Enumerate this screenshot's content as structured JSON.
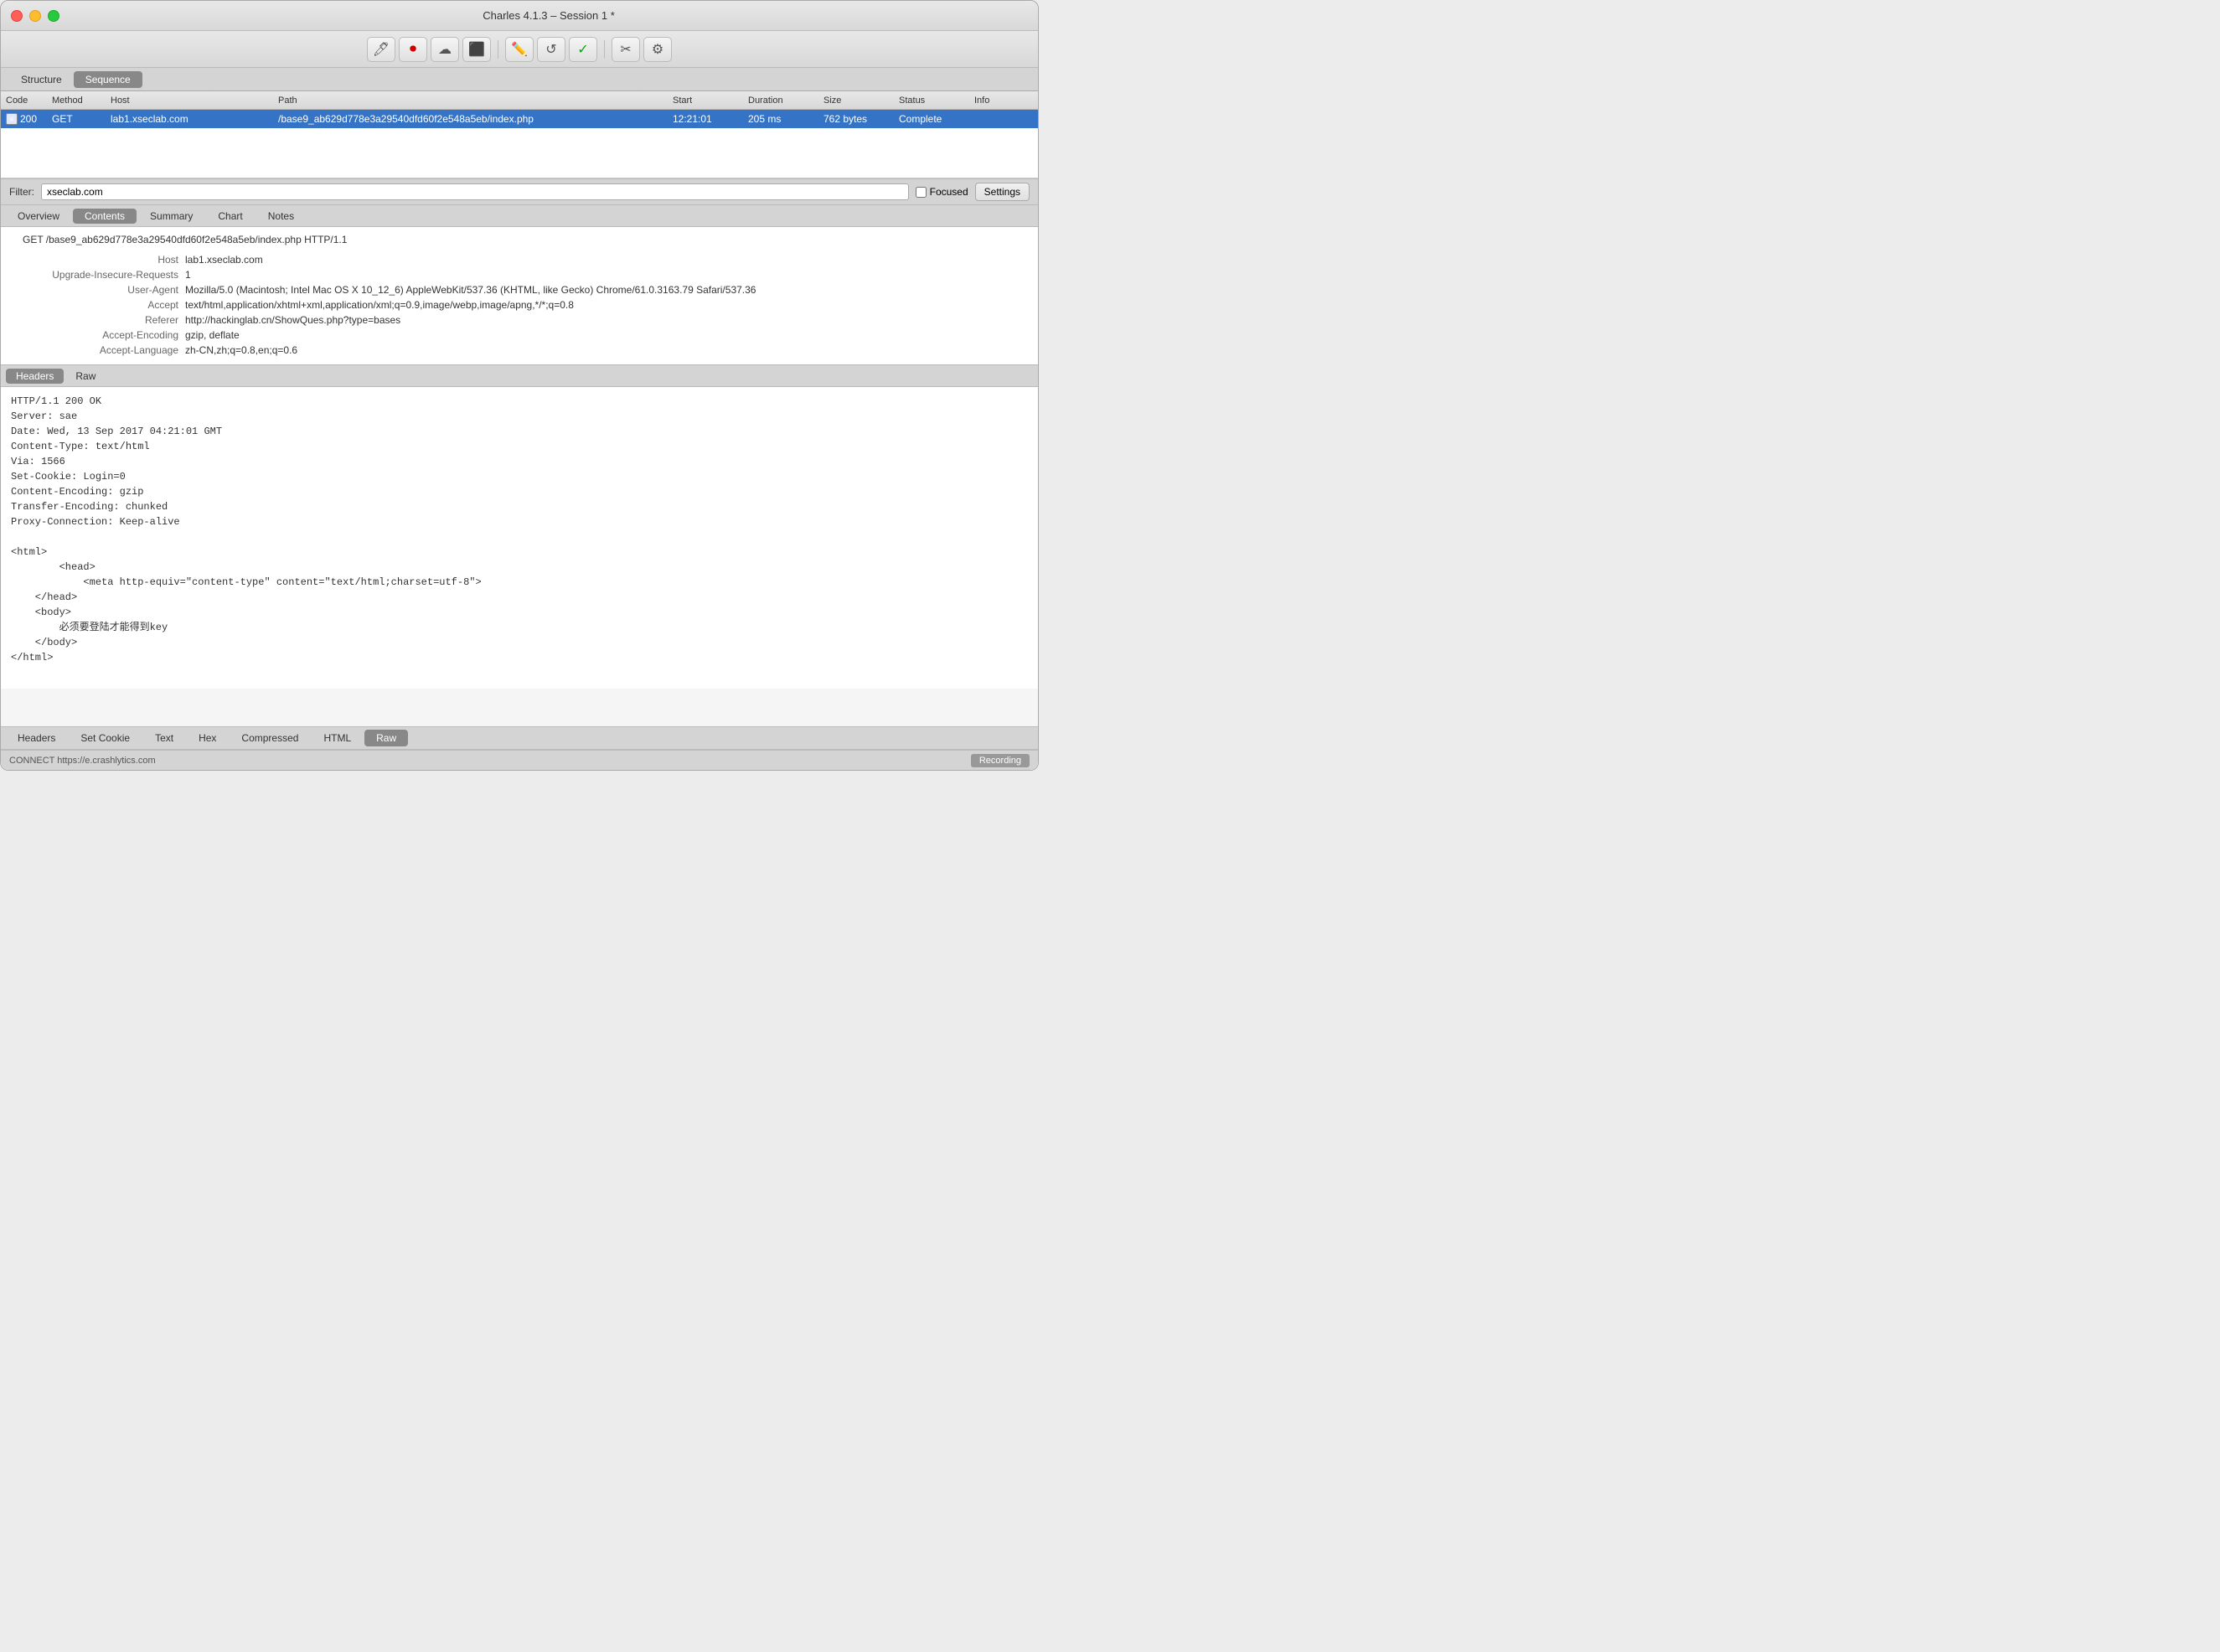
{
  "window": {
    "title": "Charles 4.1.3 – Session 1 *"
  },
  "toolbar": {
    "buttons": [
      {
        "name": "pen-tool",
        "icon": "✏️"
      },
      {
        "name": "record",
        "icon": "⏺"
      },
      {
        "name": "cloud",
        "icon": "☁"
      },
      {
        "name": "stop",
        "icon": "⏹"
      },
      {
        "name": "pencil",
        "icon": "✏"
      },
      {
        "name": "refresh",
        "icon": "↺"
      },
      {
        "name": "checkmark",
        "icon": "✓"
      },
      {
        "name": "tools",
        "icon": "✂"
      },
      {
        "name": "settings",
        "icon": "⚙"
      }
    ]
  },
  "nav": {
    "tabs": [
      "Structure",
      "Sequence"
    ],
    "active": "Sequence"
  },
  "table": {
    "headers": [
      "Code",
      "Method",
      "Host",
      "Path",
      "Start",
      "Duration",
      "Size",
      "Status",
      "Info"
    ],
    "row": {
      "icon": "≡",
      "code": "200",
      "method": "GET",
      "host": "lab1.xseclab.com",
      "path": "/base9_ab629d778e3a29540dfd60f2e548a5eb/index.php",
      "start": "12:21:01",
      "duration": "205 ms",
      "size": "762 bytes",
      "status": "Complete",
      "info": ""
    }
  },
  "filter": {
    "label": "Filter:",
    "value": "xseclab.com",
    "placeholder": "",
    "focused_label": "Focused",
    "settings_label": "Settings"
  },
  "detail": {
    "tabs": [
      "Overview",
      "Contents",
      "Summary",
      "Chart",
      "Notes"
    ],
    "active_tab": "Contents",
    "request_line": "GET /base9_ab629d778e3a29540dfd60f2e548a5eb/index.php HTTP/1.1",
    "headers": [
      {
        "name": "Host",
        "value": "lab1.xseclab.com"
      },
      {
        "name": "Upgrade-Insecure-Requests",
        "value": "1"
      },
      {
        "name": "User-Agent",
        "value": "Mozilla/5.0 (Macintosh; Intel Mac OS X 10_12_6) AppleWebKit/537.36 (KHTML, like Gecko) Chrome/61.0.3163.79 Safari/537.36"
      },
      {
        "name": "Accept",
        "value": "text/html,application/xhtml+xml,application/xml;q=0.9,image/webp,image/apng,*/*;q=0.8"
      },
      {
        "name": "Referer",
        "value": "http://hackinglab.cn/ShowQues.php?type=bases"
      },
      {
        "name": "Accept-Encoding",
        "value": "gzip, deflate"
      },
      {
        "name": "Accept-Language",
        "value": "zh-CN,zh;q=0.8,en;q=0.6"
      }
    ]
  },
  "response": {
    "tabs": [
      "Headers",
      "Raw"
    ],
    "active_tab": "Headers",
    "content": "HTTP/1.1 200 OK\nServer: sae\nDate: Wed, 13 Sep 2017 04:21:01 GMT\nContent-Type: text/html\nVia: 1566\nSet-Cookie: Login=0\nContent-Encoding: gzip\nTransfer-Encoding: chunked\nProxy-Connection: Keep-alive\n\n<html>\n        <head>\n            <meta http-equiv=\"content-type\" content=\"text/html;charset=utf-8\">\n    </head>\n    <body>\n        必须要登陆才能得到key\n    </body>\n</html>"
  },
  "bottom_tabs": {
    "tabs": [
      "Headers",
      "Set Cookie",
      "Text",
      "Hex",
      "Compressed",
      "HTML",
      "Raw"
    ],
    "active": "Raw"
  },
  "status_bar": {
    "text": "CONNECT https://e.crashlytics.com",
    "recording": "Recording"
  }
}
